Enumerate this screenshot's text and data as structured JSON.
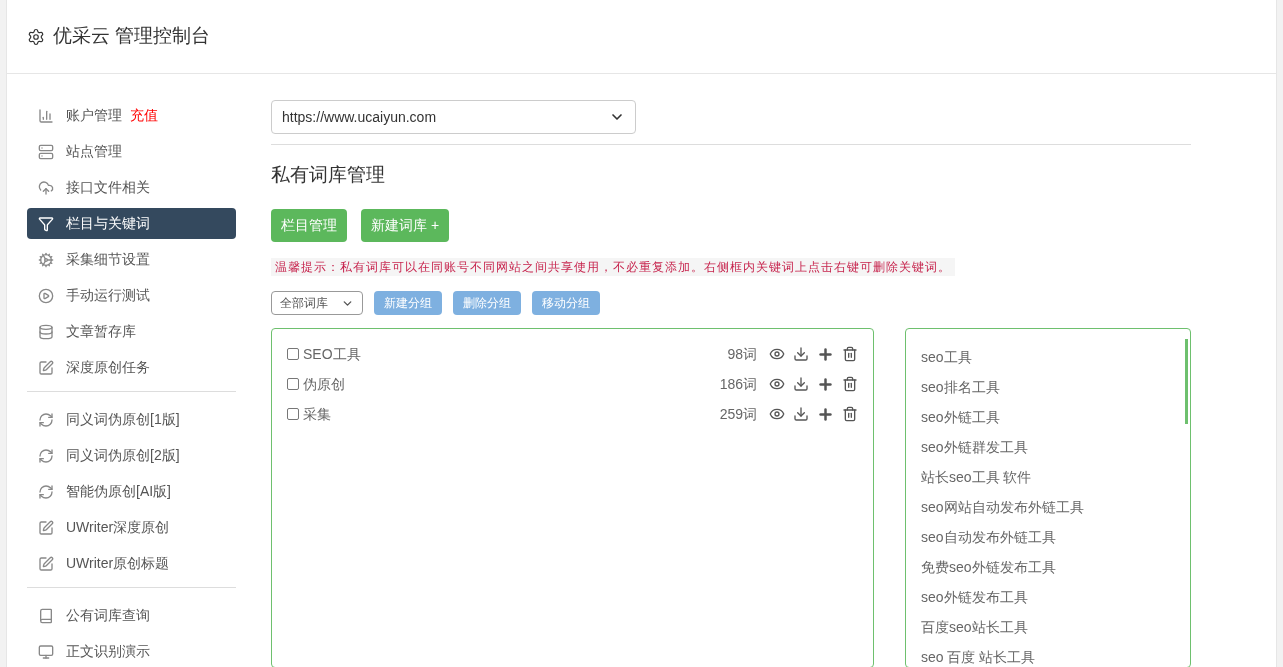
{
  "header": {
    "title": "优采云 管理控制台"
  },
  "sidebar": {
    "groups": [
      [
        {
          "kind": "chart",
          "label": "账户管理",
          "badge": "充值",
          "selected": false
        },
        {
          "kind": "server",
          "label": "站点管理",
          "selected": false
        },
        {
          "kind": "cloud",
          "label": "接口文件相关",
          "selected": false
        },
        {
          "kind": "filter",
          "label": "栏目与关键词",
          "selected": true
        },
        {
          "kind": "gears",
          "label": "采集细节设置",
          "selected": false
        },
        {
          "kind": "play",
          "label": "手动运行测试",
          "selected": false
        },
        {
          "kind": "database",
          "label": "文章暂存库",
          "selected": false
        },
        {
          "kind": "edit",
          "label": "深度原创任务",
          "selected": false
        }
      ],
      [
        {
          "kind": "refresh",
          "label": "同义词伪原创[1版]",
          "selected": false
        },
        {
          "kind": "refresh",
          "label": "同义词伪原创[2版]",
          "selected": false
        },
        {
          "kind": "refresh",
          "label": "智能伪原创[AI版]",
          "selected": false
        },
        {
          "kind": "edit",
          "label": "UWriter深度原创",
          "selected": false
        },
        {
          "kind": "edit",
          "label": "UWriter原创标题",
          "selected": false
        }
      ],
      [
        {
          "kind": "book",
          "label": "公有词库查询",
          "selected": false
        },
        {
          "kind": "monitor",
          "label": "正文识别演示",
          "selected": false
        }
      ]
    ]
  },
  "site_select": {
    "value": "https://www.ucaiyun.com"
  },
  "section_title": "私有词库管理",
  "action_buttons": [
    "栏目管理",
    "新建词库 +"
  ],
  "tip": "温馨提示：私有词库可以在同账号不同网站之间共享使用，不必重复添加。右侧框内关键词上点击右键可删除关键词。",
  "group_select": {
    "value": "全部词库"
  },
  "group_buttons": [
    "新建分组",
    "删除分组",
    "移动分组"
  ],
  "libraries": [
    {
      "name": "SEO工具",
      "count": "98词",
      "checked": false
    },
    {
      "name": "伪原创",
      "count": "186词",
      "checked": false
    },
    {
      "name": "采集",
      "count": "259词",
      "checked": false
    }
  ],
  "keywords": [
    "seo工具",
    "seo排名工具",
    "seo外链工具",
    "seo外链群发工具",
    "站长seo工具 软件",
    "seo网站自动发布外链工具",
    "seo自动发布外链工具",
    "免费seo外链发布工具",
    "seo外链发布工具",
    "百度seo站长工具",
    "seo 百度 站长工具"
  ]
}
